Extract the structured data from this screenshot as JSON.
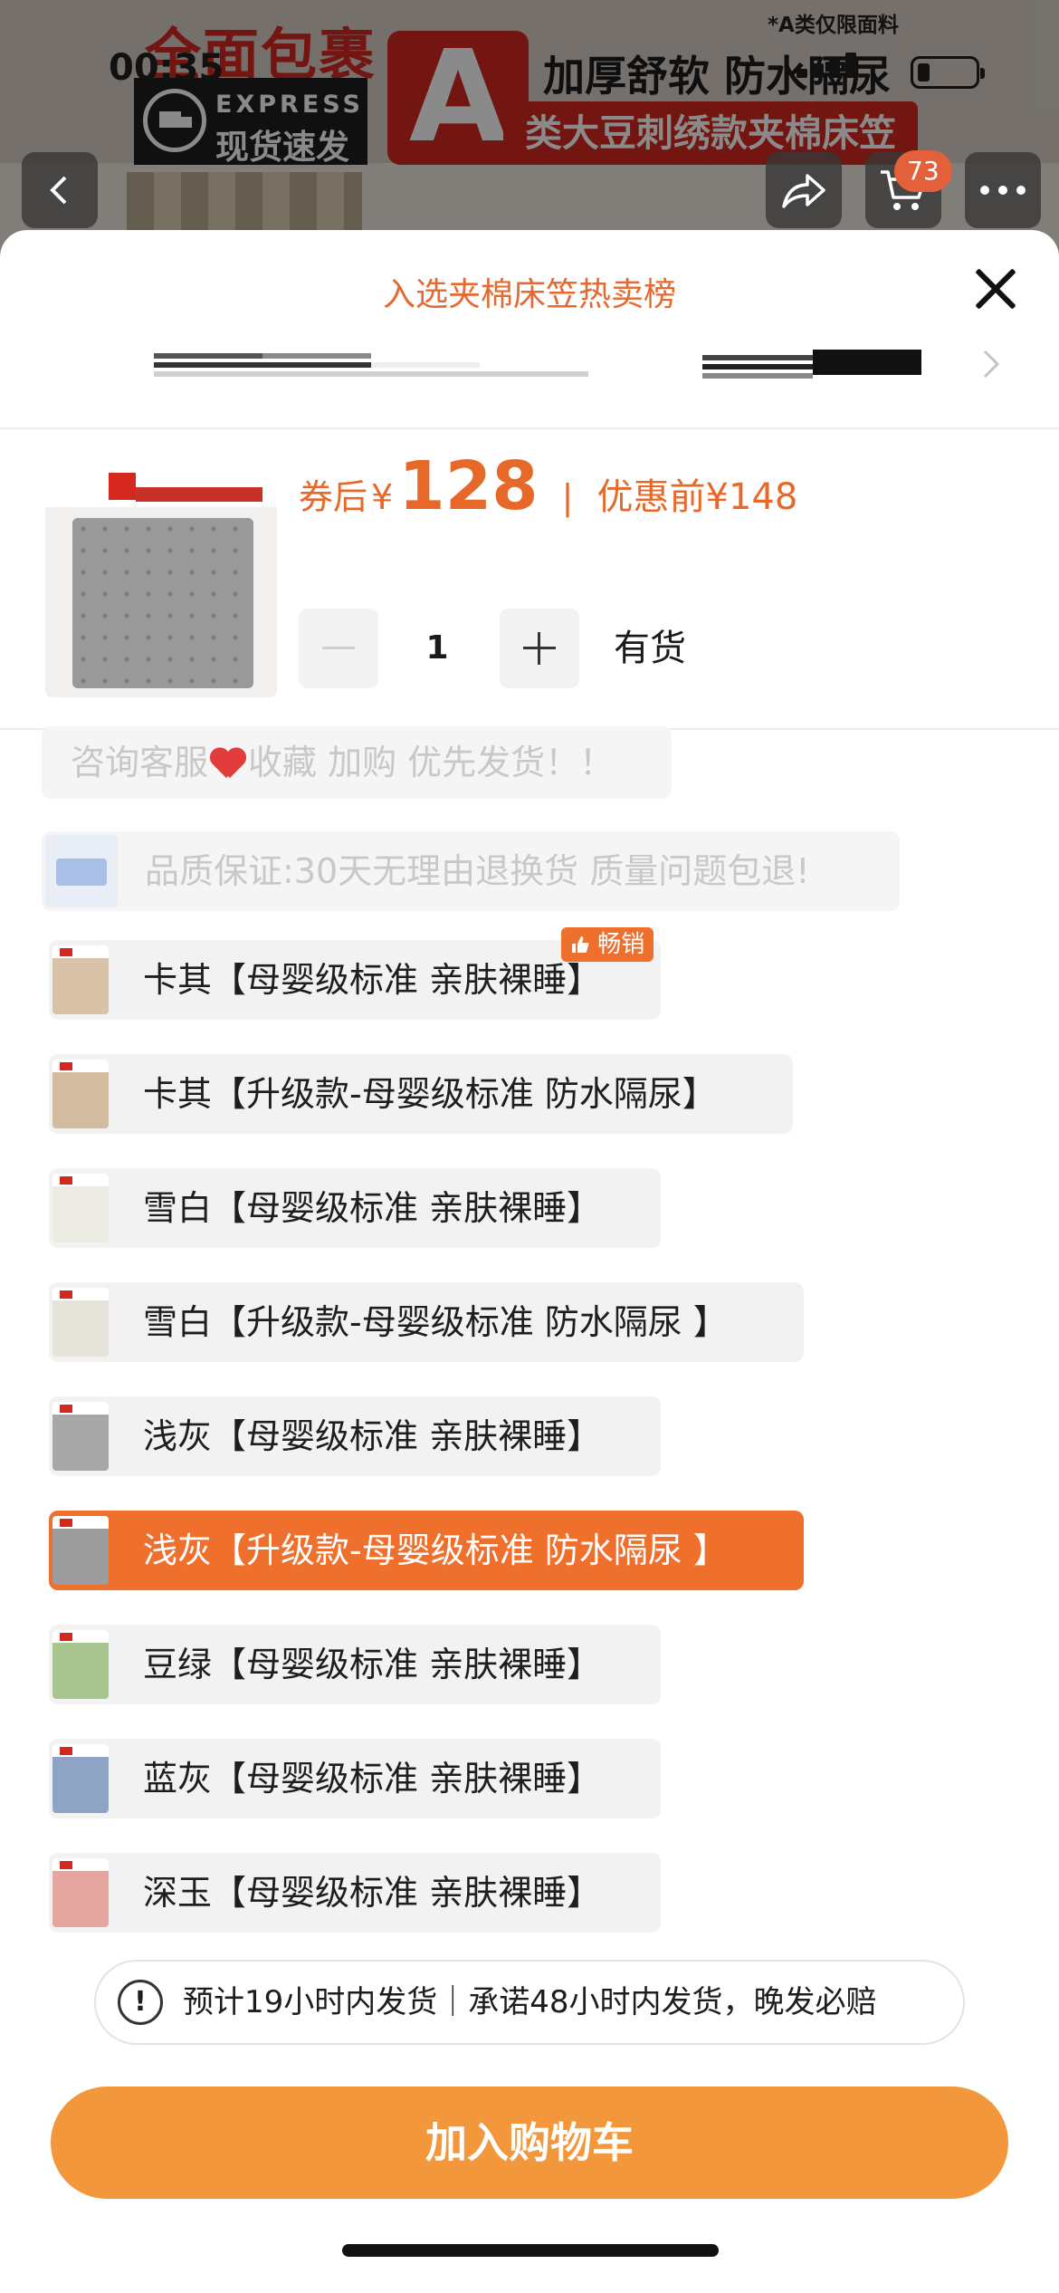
{
  "status_bar": {
    "time": "00:35"
  },
  "banner": {
    "title": "全面包裹",
    "express_en": "EXPRESS",
    "express_cn": "现货速发",
    "grade_letter": "A",
    "fabric_note": "*A类仅限面料",
    "features": "加厚舒软 防水隔尿",
    "product_line": "类大豆刺绣款夹棉床笠"
  },
  "nav": {
    "cart_count": "73",
    "icons": [
      "back-icon",
      "share-icon",
      "cart-icon",
      "more-icon"
    ]
  },
  "sheet": {
    "rank_label": "入选夹棉床笠热卖榜",
    "price": {
      "after_coupon_label": "券后",
      "currency": "¥",
      "after_coupon_value": "128",
      "divider": "|",
      "before_label": "优惠前",
      "before_value": "148"
    },
    "quantity": {
      "value": "1"
    },
    "stock_text": "有货",
    "service_pill_part1": "咨询客服",
    "service_pill_part2": "收藏 加购 优先发货！！",
    "quality_pill": "品质保证:30天无理由退换货 质量问题包退!",
    "hot_tag": "畅销",
    "skus": [
      {
        "label": "卡其【母婴级标准 亲肤裸睡】",
        "swatch": "#d8c2a8",
        "selected": false
      },
      {
        "label": "卡其【升级款-母婴级标准 防水隔尿】",
        "swatch": "#d2bb9e",
        "selected": false
      },
      {
        "label": "雪白【母婴级标准 亲肤裸睡】",
        "swatch": "#ecebe3",
        "selected": false
      },
      {
        "label": "雪白【升级款-母婴级标准 防水隔尿 】",
        "swatch": "#e6e3da",
        "selected": false
      },
      {
        "label": "浅灰【母婴级标准 亲肤裸睡】",
        "swatch": "#a7a7a7",
        "selected": false
      },
      {
        "label": "浅灰【升级款-母婴级标准 防水隔尿 】",
        "swatch": "#9c9c9c",
        "selected": true
      },
      {
        "label": "豆绿【母婴级标准 亲肤裸睡】",
        "swatch": "#a8c48f",
        "selected": false
      },
      {
        "label": "蓝灰【母婴级标准 亲肤裸睡】",
        "swatch": "#8ea4c4",
        "selected": false
      },
      {
        "label": "深玉【母婴级标准 亲肤裸睡】",
        "swatch": "#e3a7a0",
        "selected": false
      }
    ],
    "shipping_notice": "预计19小时内发货｜承诺48小时内发货，晚发必赔",
    "add_to_cart": "加入购物车"
  },
  "colors": {
    "accent": "#ef6f2c",
    "price": "#e7692a",
    "cta": "#f2973b",
    "brand_red": "#d4281e"
  }
}
